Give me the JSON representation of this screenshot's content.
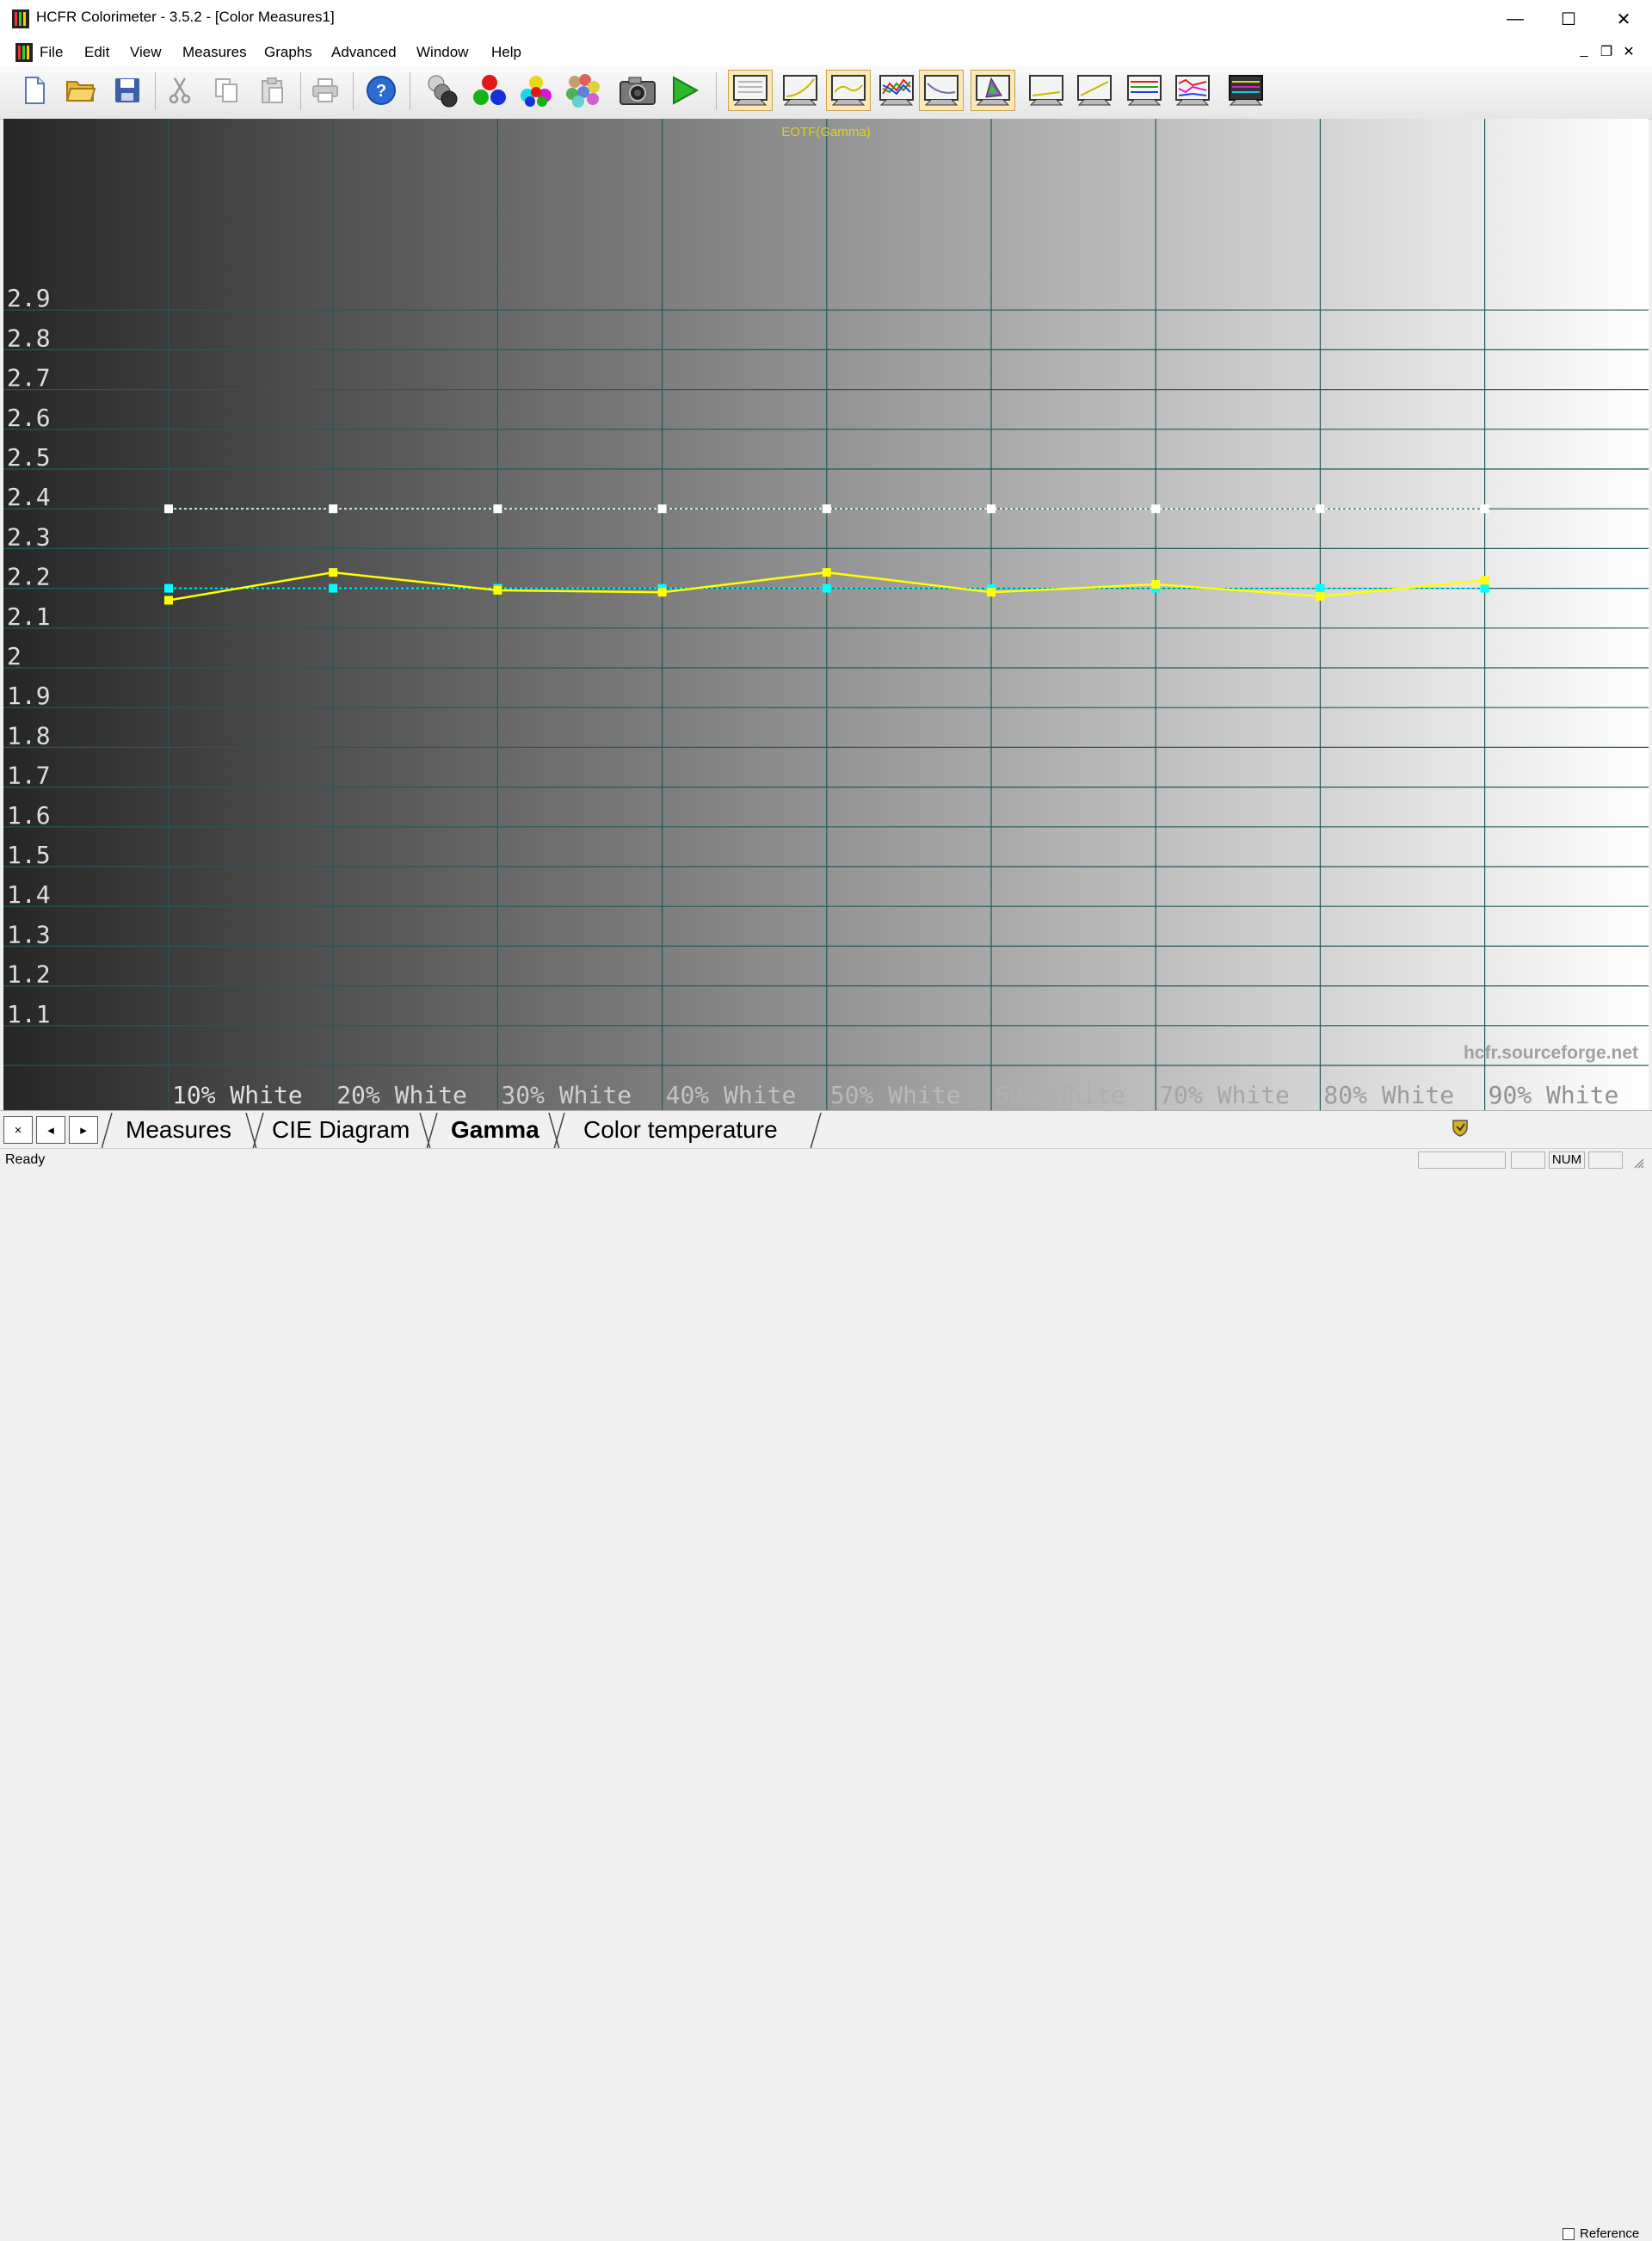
{
  "window": {
    "title": "HCFR Colorimeter - 3.5.2 - [Color Measures1]",
    "minimize": "—",
    "maximize": "☐",
    "close": "✕"
  },
  "menu": {
    "items": [
      "File",
      "Edit",
      "View",
      "Measures",
      "Graphs",
      "Advanced",
      "Window",
      "Help"
    ],
    "mdi_minimize": "_",
    "mdi_restore": "❐",
    "mdi_close": "✕"
  },
  "toolbar": {
    "buttons": [
      {
        "name": "new-icon"
      },
      {
        "name": "open-folder-icon"
      },
      {
        "name": "save-icon"
      },
      {
        "name": "cut-icon"
      },
      {
        "name": "copy-icon"
      },
      {
        "name": "paste-icon"
      },
      {
        "name": "print-icon"
      },
      {
        "name": "help-icon"
      },
      {
        "name": "gray-balls-icon"
      },
      {
        "name": "rgb-balls-icon"
      },
      {
        "name": "secondary-balls-icon"
      },
      {
        "name": "multi-balls-icon"
      },
      {
        "name": "camera-icon"
      },
      {
        "name": "play-icon"
      },
      {
        "name": "monitor-measures-icon",
        "active": true
      },
      {
        "name": "monitor-gamma-icon"
      },
      {
        "name": "monitor-gamma-active-icon",
        "active": true
      },
      {
        "name": "monitor-rgb-icon"
      },
      {
        "name": "monitor-luminance-icon",
        "active": true
      },
      {
        "name": "monitor-cie-icon",
        "active": true
      },
      {
        "name": "monitor-curve-icon"
      },
      {
        "name": "monitor-curve2-icon"
      },
      {
        "name": "monitor-lines-icon"
      },
      {
        "name": "monitor-lines2-icon"
      },
      {
        "name": "monitor-dark-icon"
      }
    ]
  },
  "chart_data": {
    "type": "line",
    "title": "EOTF(Gamma)",
    "watermark": "hcfr.sourceforge.net",
    "categories": [
      "10% White",
      "20% White",
      "30% White",
      "40% White",
      "50% White",
      "60% White",
      "70% White",
      "80% White",
      "90% White"
    ],
    "ylim": [
      1.0,
      3.0
    ],
    "yticks": [
      "2.9",
      "2.8",
      "2.7",
      "2.6",
      "2.5",
      "2.4",
      "2.3",
      "2.2",
      "2.1",
      "2",
      "1.9",
      "1.8",
      "1.7",
      "1.6",
      "1.5",
      "1.4",
      "1.3",
      "1.2",
      "1.1"
    ],
    "grid": true,
    "series": [
      {
        "values": [
          2.4,
          2.4,
          2.4,
          2.4,
          2.4,
          2.4,
          2.4,
          2.4,
          2.4
        ],
        "color": "#ffffff",
        "style": "dotted"
      },
      {
        "values": [
          2.2,
          2.2,
          2.2,
          2.2,
          2.2,
          2.2,
          2.2,
          2.2,
          2.2
        ],
        "color": "#00ffff",
        "style": "dotted"
      },
      {
        "values": [
          2.17,
          2.24,
          2.195,
          2.19,
          2.24,
          2.19,
          2.21,
          2.18,
          2.22
        ],
        "color": "#ffff00",
        "style": "solid"
      }
    ]
  },
  "tabs": {
    "close": "×",
    "prev": "◂",
    "next": "▸",
    "items": [
      {
        "label": "Measures",
        "active": false
      },
      {
        "label": "CIE Diagram",
        "active": false
      },
      {
        "label": "Gamma",
        "active": true
      },
      {
        "label": "Color temperature",
        "active": false
      }
    ]
  },
  "reference": {
    "label": "Reference",
    "checked": false
  },
  "status": {
    "text": "Ready",
    "num": "NUM"
  }
}
